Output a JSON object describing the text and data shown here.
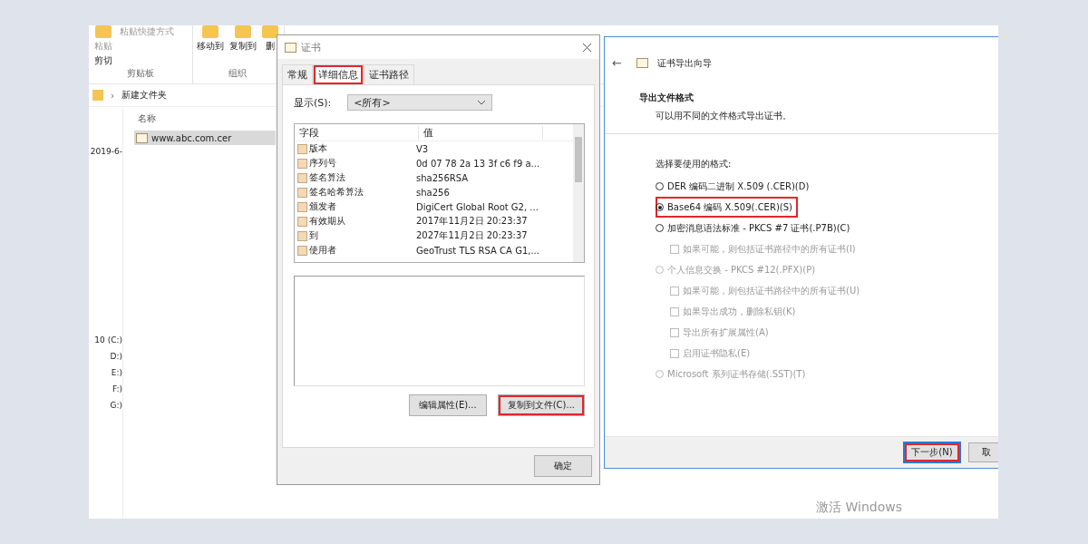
{
  "explorer": {
    "ribbon": {
      "groups": [
        {
          "label": "剪贴板",
          "items": [
            {
              "label": "粘贴",
              "kind": "large",
              "disabled": true
            },
            {
              "label": "粘贴快捷方式",
              "kind": "small",
              "disabled": true
            },
            {
              "label": "剪切",
              "kind": "small",
              "disabled": false
            }
          ]
        },
        {
          "label": "组织",
          "items": [
            {
              "label": "移动到",
              "kind": "large",
              "disabled": false
            },
            {
              "label": "复制到",
              "kind": "large",
              "disabled": false
            },
            {
              "label": "删",
              "kind": "large",
              "disabled": false
            }
          ]
        }
      ]
    },
    "breadcrumb_separator": "›",
    "breadcrumb": "新建文件夹",
    "nav_items": [
      "2019-6-",
      "10 (C:)",
      "D:)",
      "E:)",
      "F:)",
      "G:)"
    ],
    "column": "名称",
    "files": [
      {
        "name": "www.abc.com.cer",
        "selected": true
      }
    ]
  },
  "certificate_dialog": {
    "title": "证书",
    "tabs": [
      {
        "label": "常规",
        "selected": false,
        "highlighted": false
      },
      {
        "label": "详细信息",
        "selected": true,
        "highlighted": true
      },
      {
        "label": "证书路径",
        "selected": false,
        "highlighted": false
      }
    ],
    "show_label": "显示(S):",
    "show_value": "<所有>",
    "columns": [
      "字段",
      "值"
    ],
    "rows": [
      {
        "field": "版本",
        "value": "V3"
      },
      {
        "field": "序列号",
        "value": "0d 07 78 2a 13 3f c6 f9 a..."
      },
      {
        "field": "签名算法",
        "value": "sha256RSA"
      },
      {
        "field": "签名哈希算法",
        "value": "sha256"
      },
      {
        "field": "颁发者",
        "value": "DigiCert Global Root G2, ..."
      },
      {
        "field": "有效期从",
        "value": "2017年11月2日 20:23:37"
      },
      {
        "field": "到",
        "value": "2027年11月2日 20:23:37"
      },
      {
        "field": "使用者",
        "value": "GeoTrust TLS RSA CA G1,..."
      }
    ],
    "buttons": [
      {
        "label": "编辑属性(E)...",
        "highlighted": false
      },
      {
        "label": "复制到文件(C)...",
        "highlighted": true
      }
    ],
    "ok_button": "确定"
  },
  "export_wizard": {
    "back_glyph": "←",
    "title": "证书导出向导",
    "heading": "导出文件格式",
    "subtitle": "可以用不同的文件格式导出证书。",
    "prompt": "选择要使用的格式:",
    "options": [
      {
        "kind": "radio",
        "label": "DER 编码二进制 X.509 (.CER)(D)",
        "selected": false,
        "disabled": false,
        "highlighted": false
      },
      {
        "kind": "radio",
        "label": "Base64 编码 X.509(.CER)(S)",
        "selected": true,
        "disabled": false,
        "highlighted": true
      },
      {
        "kind": "radio",
        "label": "加密消息语法标准 - PKCS #7 证书(.P7B)(C)",
        "selected": false,
        "disabled": false,
        "highlighted": false
      },
      {
        "kind": "checkbox",
        "label": "如果可能，则包括证书路径中的所有证书(I)",
        "checked": false,
        "disabled": true
      },
      {
        "kind": "radio",
        "label": "个人信息交换 - PKCS #12(.PFX)(P)",
        "selected": false,
        "disabled": true,
        "highlighted": false
      },
      {
        "kind": "checkbox",
        "label": "如果可能，则包括证书路径中的所有证书(U)",
        "checked": false,
        "disabled": true
      },
      {
        "kind": "checkbox",
        "label": "如果导出成功，删除私钥(K)",
        "checked": false,
        "disabled": true
      },
      {
        "kind": "checkbox",
        "label": "导出所有扩展属性(A)",
        "checked": false,
        "disabled": true
      },
      {
        "kind": "checkbox",
        "label": "启用证书隐私(E)",
        "checked": false,
        "disabled": true
      },
      {
        "kind": "radio",
        "label": "Microsoft 系列证书存储(.SST)(T)",
        "selected": false,
        "disabled": true,
        "highlighted": false
      }
    ],
    "buttons": [
      {
        "label": "下一步(N)",
        "highlighted": true,
        "default": true
      },
      {
        "label": "取",
        "highlighted": false,
        "default": false
      }
    ]
  },
  "activation_notice": "激活 Windows"
}
